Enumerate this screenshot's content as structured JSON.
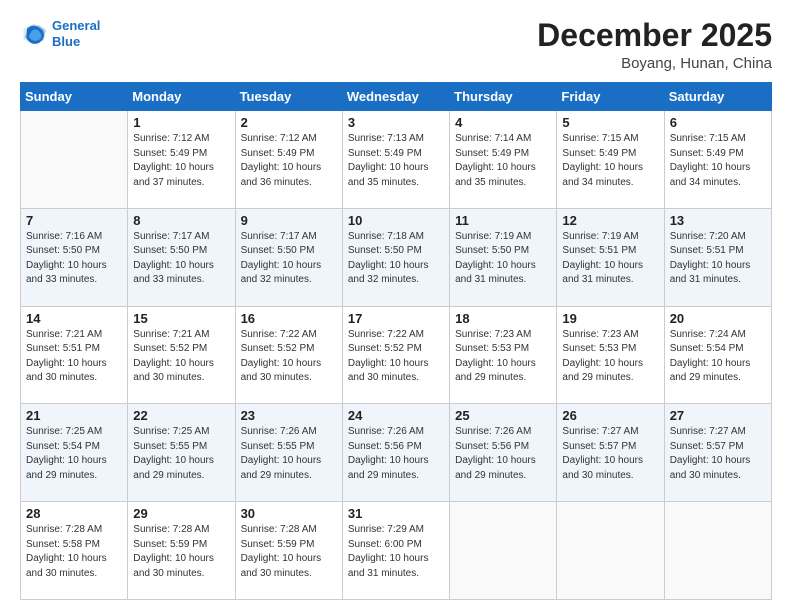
{
  "logo": {
    "line1": "General",
    "line2": "Blue"
  },
  "title": "December 2025",
  "location": "Boyang, Hunan, China",
  "days_of_week": [
    "Sunday",
    "Monday",
    "Tuesday",
    "Wednesday",
    "Thursday",
    "Friday",
    "Saturday"
  ],
  "weeks": [
    [
      {
        "day": "",
        "info": ""
      },
      {
        "day": "1",
        "info": "Sunrise: 7:12 AM\nSunset: 5:49 PM\nDaylight: 10 hours\nand 37 minutes."
      },
      {
        "day": "2",
        "info": "Sunrise: 7:12 AM\nSunset: 5:49 PM\nDaylight: 10 hours\nand 36 minutes."
      },
      {
        "day": "3",
        "info": "Sunrise: 7:13 AM\nSunset: 5:49 PM\nDaylight: 10 hours\nand 35 minutes."
      },
      {
        "day": "4",
        "info": "Sunrise: 7:14 AM\nSunset: 5:49 PM\nDaylight: 10 hours\nand 35 minutes."
      },
      {
        "day": "5",
        "info": "Sunrise: 7:15 AM\nSunset: 5:49 PM\nDaylight: 10 hours\nand 34 minutes."
      },
      {
        "day": "6",
        "info": "Sunrise: 7:15 AM\nSunset: 5:49 PM\nDaylight: 10 hours\nand 34 minutes."
      }
    ],
    [
      {
        "day": "7",
        "info": "Sunrise: 7:16 AM\nSunset: 5:50 PM\nDaylight: 10 hours\nand 33 minutes."
      },
      {
        "day": "8",
        "info": "Sunrise: 7:17 AM\nSunset: 5:50 PM\nDaylight: 10 hours\nand 33 minutes."
      },
      {
        "day": "9",
        "info": "Sunrise: 7:17 AM\nSunset: 5:50 PM\nDaylight: 10 hours\nand 32 minutes."
      },
      {
        "day": "10",
        "info": "Sunrise: 7:18 AM\nSunset: 5:50 PM\nDaylight: 10 hours\nand 32 minutes."
      },
      {
        "day": "11",
        "info": "Sunrise: 7:19 AM\nSunset: 5:50 PM\nDaylight: 10 hours\nand 31 minutes."
      },
      {
        "day": "12",
        "info": "Sunrise: 7:19 AM\nSunset: 5:51 PM\nDaylight: 10 hours\nand 31 minutes."
      },
      {
        "day": "13",
        "info": "Sunrise: 7:20 AM\nSunset: 5:51 PM\nDaylight: 10 hours\nand 31 minutes."
      }
    ],
    [
      {
        "day": "14",
        "info": "Sunrise: 7:21 AM\nSunset: 5:51 PM\nDaylight: 10 hours\nand 30 minutes."
      },
      {
        "day": "15",
        "info": "Sunrise: 7:21 AM\nSunset: 5:52 PM\nDaylight: 10 hours\nand 30 minutes."
      },
      {
        "day": "16",
        "info": "Sunrise: 7:22 AM\nSunset: 5:52 PM\nDaylight: 10 hours\nand 30 minutes."
      },
      {
        "day": "17",
        "info": "Sunrise: 7:22 AM\nSunset: 5:52 PM\nDaylight: 10 hours\nand 30 minutes."
      },
      {
        "day": "18",
        "info": "Sunrise: 7:23 AM\nSunset: 5:53 PM\nDaylight: 10 hours\nand 29 minutes."
      },
      {
        "day": "19",
        "info": "Sunrise: 7:23 AM\nSunset: 5:53 PM\nDaylight: 10 hours\nand 29 minutes."
      },
      {
        "day": "20",
        "info": "Sunrise: 7:24 AM\nSunset: 5:54 PM\nDaylight: 10 hours\nand 29 minutes."
      }
    ],
    [
      {
        "day": "21",
        "info": "Sunrise: 7:25 AM\nSunset: 5:54 PM\nDaylight: 10 hours\nand 29 minutes."
      },
      {
        "day": "22",
        "info": "Sunrise: 7:25 AM\nSunset: 5:55 PM\nDaylight: 10 hours\nand 29 minutes."
      },
      {
        "day": "23",
        "info": "Sunrise: 7:26 AM\nSunset: 5:55 PM\nDaylight: 10 hours\nand 29 minutes."
      },
      {
        "day": "24",
        "info": "Sunrise: 7:26 AM\nSunset: 5:56 PM\nDaylight: 10 hours\nand 29 minutes."
      },
      {
        "day": "25",
        "info": "Sunrise: 7:26 AM\nSunset: 5:56 PM\nDaylight: 10 hours\nand 29 minutes."
      },
      {
        "day": "26",
        "info": "Sunrise: 7:27 AM\nSunset: 5:57 PM\nDaylight: 10 hours\nand 30 minutes."
      },
      {
        "day": "27",
        "info": "Sunrise: 7:27 AM\nSunset: 5:57 PM\nDaylight: 10 hours\nand 30 minutes."
      }
    ],
    [
      {
        "day": "28",
        "info": "Sunrise: 7:28 AM\nSunset: 5:58 PM\nDaylight: 10 hours\nand 30 minutes."
      },
      {
        "day": "29",
        "info": "Sunrise: 7:28 AM\nSunset: 5:59 PM\nDaylight: 10 hours\nand 30 minutes."
      },
      {
        "day": "30",
        "info": "Sunrise: 7:28 AM\nSunset: 5:59 PM\nDaylight: 10 hours\nand 30 minutes."
      },
      {
        "day": "31",
        "info": "Sunrise: 7:29 AM\nSunset: 6:00 PM\nDaylight: 10 hours\nand 31 minutes."
      },
      {
        "day": "",
        "info": ""
      },
      {
        "day": "",
        "info": ""
      },
      {
        "day": "",
        "info": ""
      }
    ]
  ]
}
